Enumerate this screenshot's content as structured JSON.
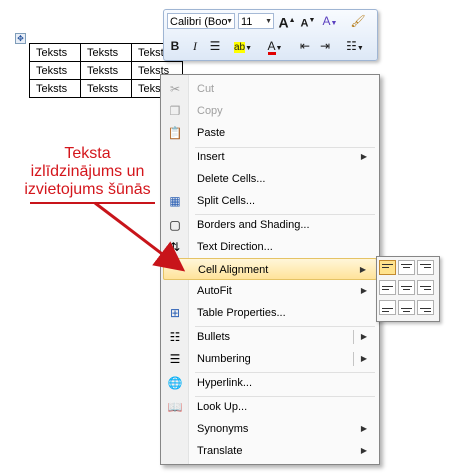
{
  "table": {
    "rows": [
      [
        "Teksts",
        "Teksts",
        "Teksts"
      ],
      [
        "Teksts",
        "Teksts",
        "Teksts"
      ],
      [
        "Teksts",
        "Teksts",
        "Teksts"
      ]
    ]
  },
  "mini_toolbar": {
    "font_name": "Calibri (Boo",
    "font_size": "11",
    "grow_font": "A",
    "shrink_font": "A",
    "bold": "B",
    "italic": "I",
    "font_color": "A"
  },
  "menu": {
    "items": [
      {
        "label": "Cut",
        "icon": "scissors-icon",
        "disabled": true
      },
      {
        "label": "Copy",
        "icon": "copy-icon",
        "disabled": true
      },
      {
        "label": "Paste",
        "icon": "paste-icon",
        "disabled": false
      },
      {
        "label": "Insert",
        "icon": "",
        "submenu": true
      },
      {
        "label": "Delete Cells...",
        "icon": ""
      },
      {
        "label": "Split Cells...",
        "icon": "split-cells-icon"
      },
      {
        "label": "Borders and Shading...",
        "icon": "borders-icon"
      },
      {
        "label": "Text Direction...",
        "icon": "text-direction-icon"
      },
      {
        "label": "Cell Alignment",
        "icon": "",
        "submenu": true,
        "highlighted": true
      },
      {
        "label": "AutoFit",
        "icon": "",
        "submenu": true
      },
      {
        "label": "Table Properties...",
        "icon": "table-properties-icon"
      },
      {
        "label": "Bullets",
        "icon": "bullets-icon",
        "submenu": true
      },
      {
        "label": "Numbering",
        "icon": "numbering-icon",
        "submenu": true
      },
      {
        "label": "Hyperlink...",
        "icon": "hyperlink-icon"
      },
      {
        "label": "Look Up...",
        "icon": "lookup-icon"
      },
      {
        "label": "Synonyms",
        "icon": "",
        "submenu": true
      },
      {
        "label": "Translate",
        "icon": "",
        "submenu": true
      }
    ]
  },
  "callout": {
    "lines": [
      "Teksta",
      "izlīdzinājums un",
      "izvietojums šūnās"
    ],
    "color": "#d4161c"
  },
  "colors": {
    "highlight": "#ffe39a",
    "menu_border": "#868686"
  }
}
